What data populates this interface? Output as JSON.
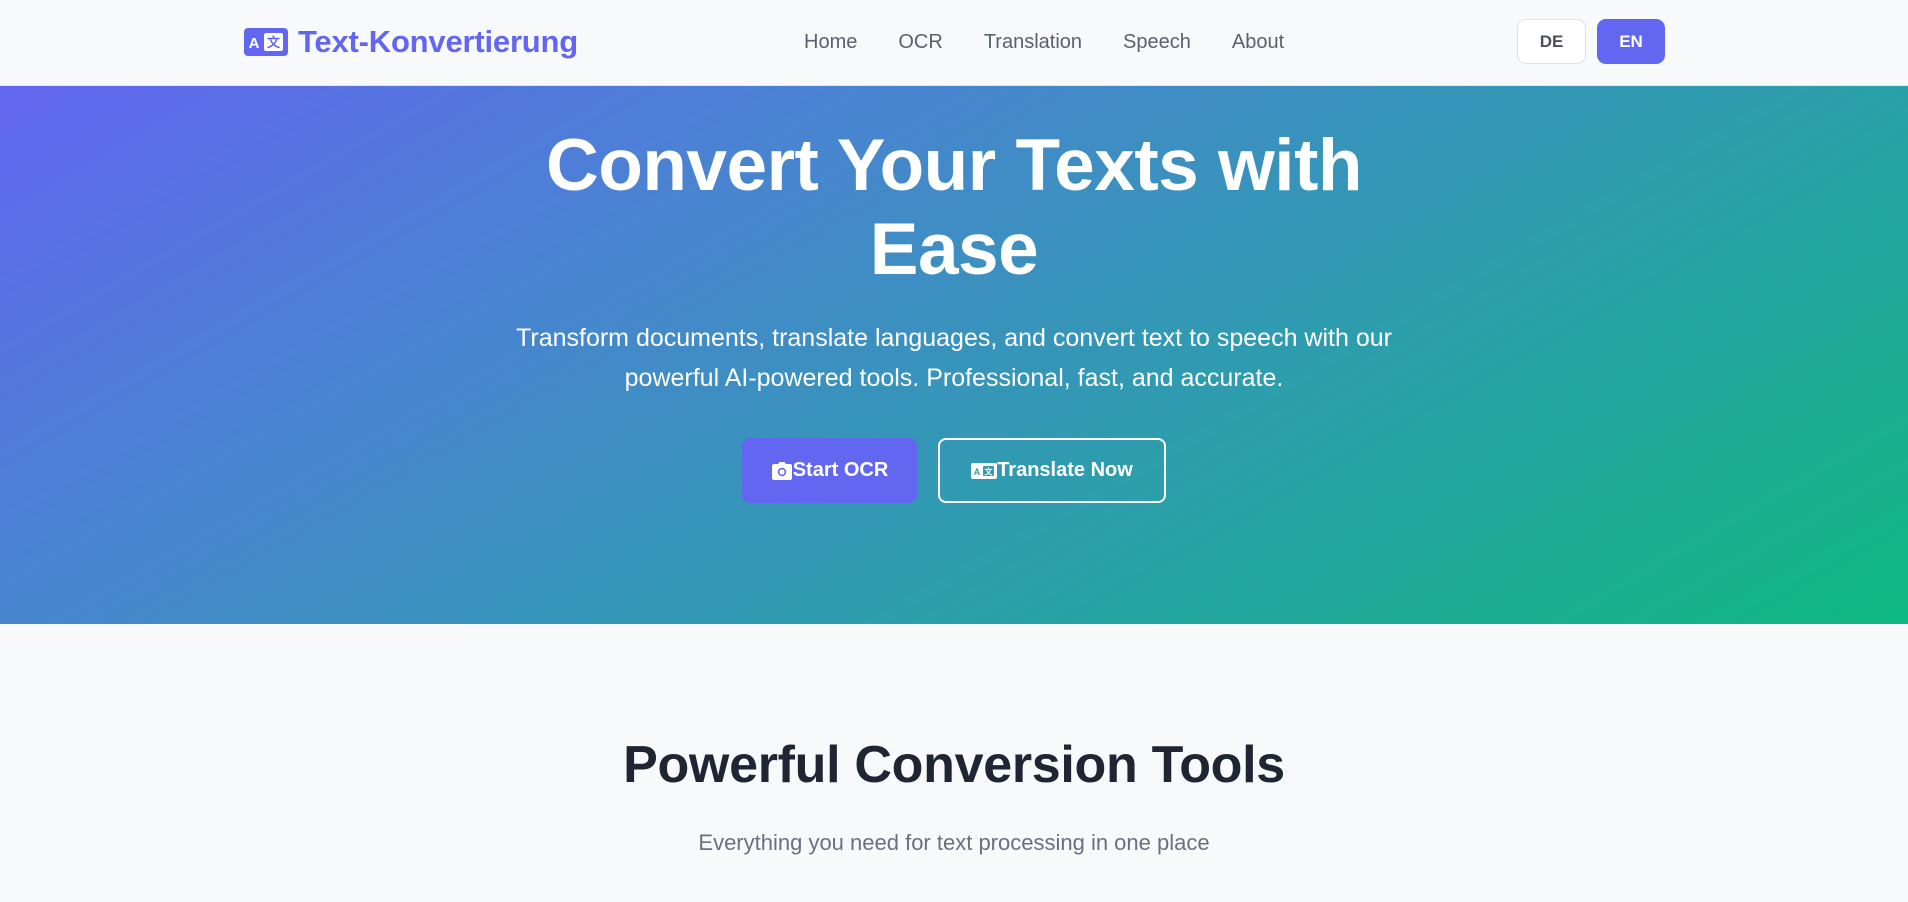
{
  "colors": {
    "accent": "#6366f1",
    "gradient_start": "#6366f1",
    "gradient_end": "#10b981",
    "page_background": "#f8f9fb",
    "heading_text": "#1f2533",
    "muted_text": "#6b7080"
  },
  "header": {
    "brand": {
      "icon": "translate-icon",
      "name": "Text-Konvertierung"
    },
    "nav": [
      {
        "label": "Home"
      },
      {
        "label": "OCR"
      },
      {
        "label": "Translation"
      },
      {
        "label": "Speech"
      },
      {
        "label": "About"
      }
    ],
    "languages": [
      {
        "label": "DE",
        "active": false
      },
      {
        "label": "EN",
        "active": true
      }
    ]
  },
  "hero": {
    "title_line1": "Convert Your Texts with",
    "title_line2": "Ease",
    "subtitle_line1": "Transform documents, translate languages, and convert text to speech with our",
    "subtitle_line2": "powerful AI-powered tools. Professional, fast, and accurate.",
    "primary_button": {
      "icon": "camera-icon",
      "label": "Start OCR"
    },
    "secondary_button": {
      "icon": "translate-icon",
      "label": "Translate Now"
    }
  },
  "tools_section": {
    "title": "Powerful Conversion Tools",
    "subtitle": "Everything you need for text processing in one place"
  }
}
